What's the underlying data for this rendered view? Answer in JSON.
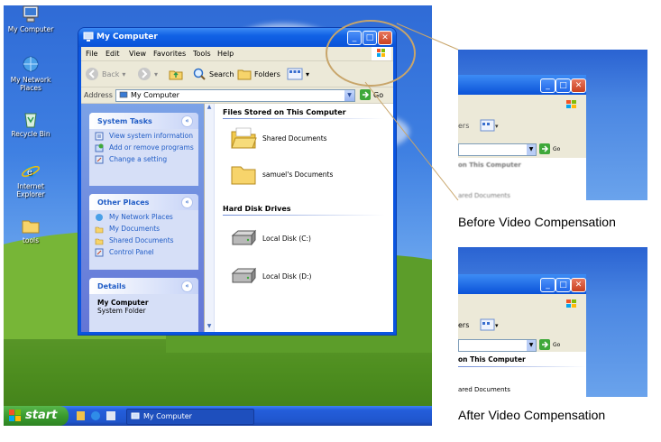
{
  "desktop": {
    "icons": [
      {
        "label": "My Computer",
        "icon": "computer-icon"
      },
      {
        "label": "My Network Places",
        "icon": "network-icon"
      },
      {
        "label": "Recycle Bin",
        "icon": "recycle-bin-icon"
      },
      {
        "label": "Internet Explorer",
        "icon": "ie-icon"
      },
      {
        "label": "tools",
        "icon": "folder-icon"
      }
    ]
  },
  "window": {
    "title": "My Computer",
    "menu": [
      "File",
      "Edit",
      "View",
      "Favorites",
      "Tools",
      "Help"
    ],
    "toolbar": {
      "back": "Back",
      "search": "Search",
      "folders": "Folders"
    },
    "address": {
      "label": "Address",
      "value": "My Computer",
      "go": "Go"
    },
    "left_panels": {
      "system_tasks": {
        "title": "System Tasks",
        "items": [
          "View system information",
          "Add or remove programs",
          "Change a setting"
        ]
      },
      "other_places": {
        "title": "Other Places",
        "items": [
          "My Network Places",
          "My Documents",
          "Shared Documents",
          "Control Panel"
        ]
      },
      "details": {
        "title": "Details",
        "name": "My Computer",
        "type": "System Folder"
      }
    },
    "groups": {
      "files": {
        "title": "Files Stored on This Computer",
        "items": [
          "Shared Documents",
          "samuel's Documents"
        ]
      },
      "drives": {
        "title": "Hard Disk Drives",
        "items": [
          "Local Disk (C:)",
          "Local Disk (D:)"
        ]
      }
    }
  },
  "taskbar": {
    "start": "start",
    "task": "My Computer"
  },
  "zoom_before": {
    "caption": "Before Video Compensation",
    "fragment_toolbar": "ers",
    "fragment_header": "on This Computer",
    "fragment_item": "ared Documents",
    "go": "Go"
  },
  "zoom_after": {
    "caption": "After Video Compensation",
    "fragment_toolbar": "ers",
    "fragment_header": "on This Computer",
    "fragment_item": "ared Documents",
    "go": "Go"
  },
  "colors": {
    "xp_blue": "#0a55e0",
    "start_green": "#3a9b2e",
    "callout_ring": "#c8a56a"
  }
}
